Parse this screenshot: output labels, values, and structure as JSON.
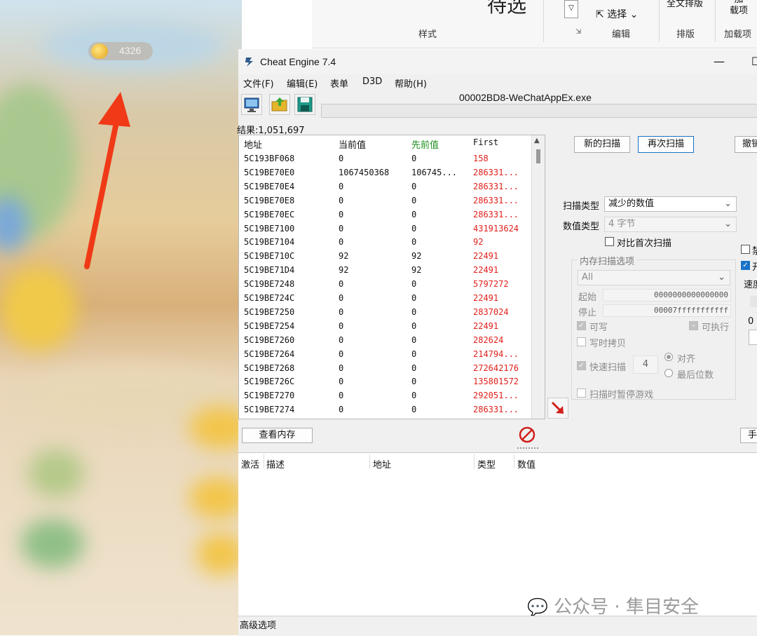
{
  "game": {
    "coin_count": "4326"
  },
  "word_ribbon": {
    "big_text": "待选",
    "styles_label": "样式",
    "select_label": "选择",
    "edit_label": "编辑",
    "layout_label": "排版",
    "addins_label": "加载项",
    "addins_btn": "加\n载项",
    "top_text": "全文排版"
  },
  "window": {
    "title": "Cheat Engine 7.4",
    "minimize": "—"
  },
  "menu": [
    "文件(F)",
    "编辑(E)",
    "表单",
    "D3D",
    "帮助(H)"
  ],
  "process": {
    "name": "00002BD8-WeChatAppEx.exe"
  },
  "results": {
    "label": "结果:1,051,697",
    "columns": [
      "地址",
      "当前值",
      "先前值",
      "First"
    ],
    "rows": [
      [
        "5C193BF068",
        "0",
        "0",
        "158"
      ],
      [
        "5C19BE70E0",
        "1067450368",
        "106745...",
        "286331..."
      ],
      [
        "5C19BE70E4",
        "0",
        "0",
        "286331..."
      ],
      [
        "5C19BE70E8",
        "0",
        "0",
        "286331..."
      ],
      [
        "5C19BE70EC",
        "0",
        "0",
        "286331..."
      ],
      [
        "5C19BE7100",
        "0",
        "0",
        "431913624"
      ],
      [
        "5C19BE7104",
        "0",
        "0",
        "92"
      ],
      [
        "5C19BE710C",
        "92",
        "92",
        "22491"
      ],
      [
        "5C19BE71D4",
        "92",
        "92",
        "22491"
      ],
      [
        "5C19BE7248",
        "0",
        "0",
        "5797272"
      ],
      [
        "5C19BE724C",
        "0",
        "0",
        "22491"
      ],
      [
        "5C19BE7250",
        "0",
        "0",
        "2837024"
      ],
      [
        "5C19BE7254",
        "0",
        "0",
        "22491"
      ],
      [
        "5C19BE7260",
        "0",
        "0",
        "282624"
      ],
      [
        "5C19BE7264",
        "0",
        "0",
        "214794..."
      ],
      [
        "5C19BE7268",
        "0",
        "0",
        "272642176"
      ],
      [
        "5C19BE726C",
        "0",
        "0",
        "135801572"
      ],
      [
        "5C19BE7270",
        "0",
        "0",
        "292051..."
      ],
      [
        "5C19BE7274",
        "0",
        "0",
        "286331..."
      ]
    ]
  },
  "scan": {
    "new_scan": "新的扫描",
    "next_scan": "再次扫描",
    "undo_scan": "撤销",
    "scan_type_label": "扫描类型",
    "scan_type_value": "减少的数值",
    "value_type_label": "数值类型",
    "value_type_value": "4 字节",
    "compare_first": "对比首次扫描",
    "mem_options_title": "内存扫描选项",
    "region_value": "All",
    "start_label": "起始",
    "start_value": "0000000000000000",
    "stop_label": "停止",
    "stop_value": "00007fffffffffff",
    "writable": "可写",
    "executable": "可执行",
    "copy_on_write": "写时拷贝",
    "fast_scan": "快速扫描",
    "fast_scan_value": "4",
    "align": "对齐",
    "last_digits": "最后位数",
    "pause_game": "扫描时暂停游戏",
    "speed_label": "速度",
    "zero_label": "0",
    "right_chk1": "禁",
    "right_chk2": "开"
  },
  "view_memory": "查看内存",
  "manual_add": "手",
  "address_table": {
    "columns": [
      "激活",
      "描述",
      "地址",
      "类型",
      "数值"
    ]
  },
  "advanced_options": "高级选项",
  "watermark": "公众号 · 隼目安全",
  "colors": {
    "red_value": "#e0201b",
    "green_header": "#1f8f1f",
    "arrow": "#f03a17"
  }
}
